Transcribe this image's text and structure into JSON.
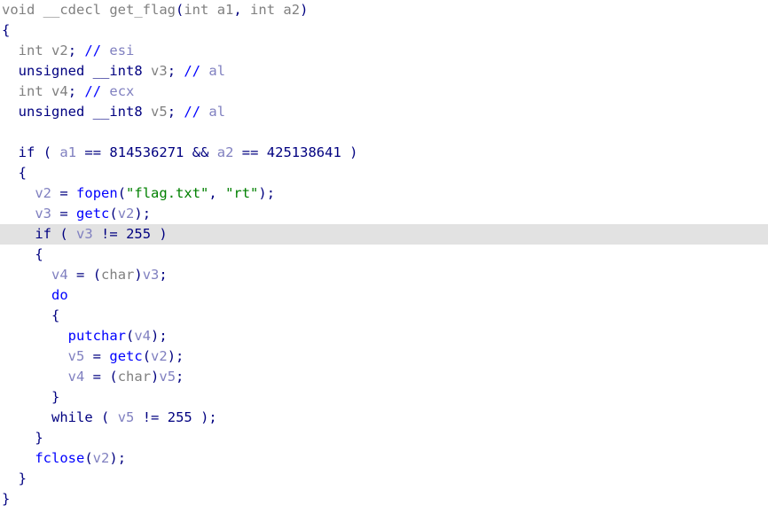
{
  "view": {
    "name": "decompiler-pseudocode",
    "background_color": "#ffffff",
    "current_line_highlight_color": "#e2e2e2",
    "current_line_index": 12
  },
  "colors": {
    "keyword": "#000080",
    "type": "#808080",
    "function_name": "#808080",
    "library_function": "#0000ff",
    "local_variable": "#8080c0",
    "number": "#000080",
    "string": "#008000",
    "comment": "#8080c0",
    "comment_marker": "#0000ff",
    "punctuation": "#000080"
  },
  "code": {
    "language": "c-pseudocode",
    "function_name": "get_flag",
    "lines": [
      {
        "index": 0,
        "indent": 0,
        "current": false,
        "tokens": [
          {
            "t": "void",
            "c": "type"
          },
          {
            "t": " ",
            "c": "plain"
          },
          {
            "t": "__cdecl",
            "c": "type"
          },
          {
            "t": " ",
            "c": "plain"
          },
          {
            "t": "get_flag",
            "c": "funcname"
          },
          {
            "t": "(",
            "c": "punct"
          },
          {
            "t": "int",
            "c": "type"
          },
          {
            "t": " ",
            "c": "plain"
          },
          {
            "t": "a1",
            "c": "type"
          },
          {
            "t": ",",
            "c": "punct"
          },
          {
            "t": " ",
            "c": "plain"
          },
          {
            "t": "int",
            "c": "type"
          },
          {
            "t": " ",
            "c": "plain"
          },
          {
            "t": "a2",
            "c": "type"
          },
          {
            "t": ")",
            "c": "punct"
          }
        ]
      },
      {
        "index": 1,
        "indent": 0,
        "current": false,
        "tokens": [
          {
            "t": "{",
            "c": "punct"
          }
        ]
      },
      {
        "index": 2,
        "indent": 2,
        "current": false,
        "tokens": [
          {
            "t": "int",
            "c": "type"
          },
          {
            "t": " ",
            "c": "plain"
          },
          {
            "t": "v2",
            "c": "type"
          },
          {
            "t": ";",
            "c": "punct"
          },
          {
            "t": " ",
            "c": "plain"
          },
          {
            "t": "//",
            "c": "commentmark"
          },
          {
            "t": " ",
            "c": "plain"
          },
          {
            "t": "esi",
            "c": "comment"
          }
        ]
      },
      {
        "index": 3,
        "indent": 2,
        "current": false,
        "tokens": [
          {
            "t": "unsigned",
            "c": "keyword"
          },
          {
            "t": " ",
            "c": "plain"
          },
          {
            "t": "__int8",
            "c": "keyword"
          },
          {
            "t": " ",
            "c": "plain"
          },
          {
            "t": "v3",
            "c": "type"
          },
          {
            "t": ";",
            "c": "punct"
          },
          {
            "t": " ",
            "c": "plain"
          },
          {
            "t": "//",
            "c": "commentmark"
          },
          {
            "t": " ",
            "c": "plain"
          },
          {
            "t": "al",
            "c": "comment"
          }
        ]
      },
      {
        "index": 4,
        "indent": 2,
        "current": false,
        "tokens": [
          {
            "t": "int",
            "c": "type"
          },
          {
            "t": " ",
            "c": "plain"
          },
          {
            "t": "v4",
            "c": "type"
          },
          {
            "t": ";",
            "c": "punct"
          },
          {
            "t": " ",
            "c": "plain"
          },
          {
            "t": "//",
            "c": "commentmark"
          },
          {
            "t": " ",
            "c": "plain"
          },
          {
            "t": "ecx",
            "c": "comment"
          }
        ]
      },
      {
        "index": 5,
        "indent": 2,
        "current": false,
        "tokens": [
          {
            "t": "unsigned",
            "c": "keyword"
          },
          {
            "t": " ",
            "c": "plain"
          },
          {
            "t": "__int8",
            "c": "keyword"
          },
          {
            "t": " ",
            "c": "plain"
          },
          {
            "t": "v5",
            "c": "type"
          },
          {
            "t": ";",
            "c": "punct"
          },
          {
            "t": " ",
            "c": "plain"
          },
          {
            "t": "//",
            "c": "commentmark"
          },
          {
            "t": " ",
            "c": "plain"
          },
          {
            "t": "al",
            "c": "comment"
          }
        ]
      },
      {
        "index": 6,
        "indent": 0,
        "current": false,
        "tokens": []
      },
      {
        "index": 7,
        "indent": 2,
        "current": false,
        "tokens": [
          {
            "t": "if",
            "c": "keyword"
          },
          {
            "t": " ",
            "c": "plain"
          },
          {
            "t": "(",
            "c": "punct"
          },
          {
            "t": " ",
            "c": "plain"
          },
          {
            "t": "a1",
            "c": "localvar"
          },
          {
            "t": " ",
            "c": "plain"
          },
          {
            "t": "==",
            "c": "operator"
          },
          {
            "t": " ",
            "c": "plain"
          },
          {
            "t": "814536271",
            "c": "number"
          },
          {
            "t": " ",
            "c": "plain"
          },
          {
            "t": "&&",
            "c": "operator"
          },
          {
            "t": " ",
            "c": "plain"
          },
          {
            "t": "a2",
            "c": "localvar"
          },
          {
            "t": " ",
            "c": "plain"
          },
          {
            "t": "==",
            "c": "operator"
          },
          {
            "t": " ",
            "c": "plain"
          },
          {
            "t": "425138641",
            "c": "number"
          },
          {
            "t": " ",
            "c": "plain"
          },
          {
            "t": ")",
            "c": "punct"
          }
        ]
      },
      {
        "index": 8,
        "indent": 2,
        "current": false,
        "tokens": [
          {
            "t": "{",
            "c": "punct"
          }
        ]
      },
      {
        "index": 9,
        "indent": 4,
        "current": false,
        "tokens": [
          {
            "t": "v2",
            "c": "localvar"
          },
          {
            "t": " ",
            "c": "plain"
          },
          {
            "t": "=",
            "c": "operator"
          },
          {
            "t": " ",
            "c": "plain"
          },
          {
            "t": "fopen",
            "c": "libfunc"
          },
          {
            "t": "(",
            "c": "punct"
          },
          {
            "t": "\"flag.txt\"",
            "c": "string"
          },
          {
            "t": ",",
            "c": "punct"
          },
          {
            "t": " ",
            "c": "plain"
          },
          {
            "t": "\"rt\"",
            "c": "string"
          },
          {
            "t": ")",
            "c": "punct"
          },
          {
            "t": ";",
            "c": "punct"
          }
        ]
      },
      {
        "index": 10,
        "indent": 4,
        "current": false,
        "tokens": [
          {
            "t": "v3",
            "c": "localvar"
          },
          {
            "t": " ",
            "c": "plain"
          },
          {
            "t": "=",
            "c": "operator"
          },
          {
            "t": " ",
            "c": "plain"
          },
          {
            "t": "getc",
            "c": "libfunc"
          },
          {
            "t": "(",
            "c": "punct"
          },
          {
            "t": "v2",
            "c": "localvar"
          },
          {
            "t": ")",
            "c": "punct"
          },
          {
            "t": ";",
            "c": "punct"
          }
        ]
      },
      {
        "index": 11,
        "indent": 4,
        "current": true,
        "tokens": [
          {
            "t": "if",
            "c": "keyword"
          },
          {
            "t": " ",
            "c": "plain"
          },
          {
            "t": "(",
            "c": "punct"
          },
          {
            "t": " ",
            "c": "plain"
          },
          {
            "t": "v3",
            "c": "localvar"
          },
          {
            "t": " ",
            "c": "plain"
          },
          {
            "t": "!=",
            "c": "operator"
          },
          {
            "t": " ",
            "c": "plain"
          },
          {
            "t": "255",
            "c": "number"
          },
          {
            "t": " ",
            "c": "plain"
          },
          {
            "t": ")",
            "c": "punct"
          }
        ]
      },
      {
        "index": 12,
        "indent": 4,
        "current": false,
        "tokens": [
          {
            "t": "{",
            "c": "punct"
          }
        ]
      },
      {
        "index": 13,
        "indent": 6,
        "current": false,
        "tokens": [
          {
            "t": "v4",
            "c": "localvar"
          },
          {
            "t": " ",
            "c": "plain"
          },
          {
            "t": "=",
            "c": "operator"
          },
          {
            "t": " ",
            "c": "plain"
          },
          {
            "t": "(",
            "c": "punct"
          },
          {
            "t": "char",
            "c": "type"
          },
          {
            "t": ")",
            "c": "punct"
          },
          {
            "t": "v3",
            "c": "localvar"
          },
          {
            "t": ";",
            "c": "punct"
          }
        ]
      },
      {
        "index": 14,
        "indent": 6,
        "current": false,
        "tokens": [
          {
            "t": "do",
            "c": "libfunc"
          }
        ]
      },
      {
        "index": 15,
        "indent": 6,
        "current": false,
        "tokens": [
          {
            "t": "{",
            "c": "punct"
          }
        ]
      },
      {
        "index": 16,
        "indent": 8,
        "current": false,
        "tokens": [
          {
            "t": "putchar",
            "c": "libfunc"
          },
          {
            "t": "(",
            "c": "punct"
          },
          {
            "t": "v4",
            "c": "localvar"
          },
          {
            "t": ")",
            "c": "punct"
          },
          {
            "t": ";",
            "c": "punct"
          }
        ]
      },
      {
        "index": 17,
        "indent": 8,
        "current": false,
        "tokens": [
          {
            "t": "v5",
            "c": "localvar"
          },
          {
            "t": " ",
            "c": "plain"
          },
          {
            "t": "=",
            "c": "operator"
          },
          {
            "t": " ",
            "c": "plain"
          },
          {
            "t": "getc",
            "c": "libfunc"
          },
          {
            "t": "(",
            "c": "punct"
          },
          {
            "t": "v2",
            "c": "localvar"
          },
          {
            "t": ")",
            "c": "punct"
          },
          {
            "t": ";",
            "c": "punct"
          }
        ]
      },
      {
        "index": 18,
        "indent": 8,
        "current": false,
        "tokens": [
          {
            "t": "v4",
            "c": "localvar"
          },
          {
            "t": " ",
            "c": "plain"
          },
          {
            "t": "=",
            "c": "operator"
          },
          {
            "t": " ",
            "c": "plain"
          },
          {
            "t": "(",
            "c": "punct"
          },
          {
            "t": "char",
            "c": "type"
          },
          {
            "t": ")",
            "c": "punct"
          },
          {
            "t": "v5",
            "c": "localvar"
          },
          {
            "t": ";",
            "c": "punct"
          }
        ]
      },
      {
        "index": 19,
        "indent": 6,
        "current": false,
        "tokens": [
          {
            "t": "}",
            "c": "punct"
          }
        ]
      },
      {
        "index": 20,
        "indent": 6,
        "current": false,
        "tokens": [
          {
            "t": "while",
            "c": "keyword"
          },
          {
            "t": " ",
            "c": "plain"
          },
          {
            "t": "(",
            "c": "punct"
          },
          {
            "t": " ",
            "c": "plain"
          },
          {
            "t": "v5",
            "c": "localvar"
          },
          {
            "t": " ",
            "c": "plain"
          },
          {
            "t": "!=",
            "c": "operator"
          },
          {
            "t": " ",
            "c": "plain"
          },
          {
            "t": "255",
            "c": "number"
          },
          {
            "t": " ",
            "c": "plain"
          },
          {
            "t": ")",
            "c": "punct"
          },
          {
            "t": ";",
            "c": "punct"
          }
        ]
      },
      {
        "index": 21,
        "indent": 4,
        "current": false,
        "tokens": [
          {
            "t": "}",
            "c": "punct"
          }
        ]
      },
      {
        "index": 22,
        "indent": 4,
        "current": false,
        "tokens": [
          {
            "t": "fclose",
            "c": "libfunc"
          },
          {
            "t": "(",
            "c": "punct"
          },
          {
            "t": "v2",
            "c": "localvar"
          },
          {
            "t": ")",
            "c": "punct"
          },
          {
            "t": ";",
            "c": "punct"
          }
        ]
      },
      {
        "index": 23,
        "indent": 2,
        "current": false,
        "tokens": [
          {
            "t": "}",
            "c": "punct"
          }
        ]
      },
      {
        "index": 24,
        "indent": 0,
        "current": false,
        "tokens": [
          {
            "t": "}",
            "c": "punct"
          }
        ]
      }
    ]
  }
}
